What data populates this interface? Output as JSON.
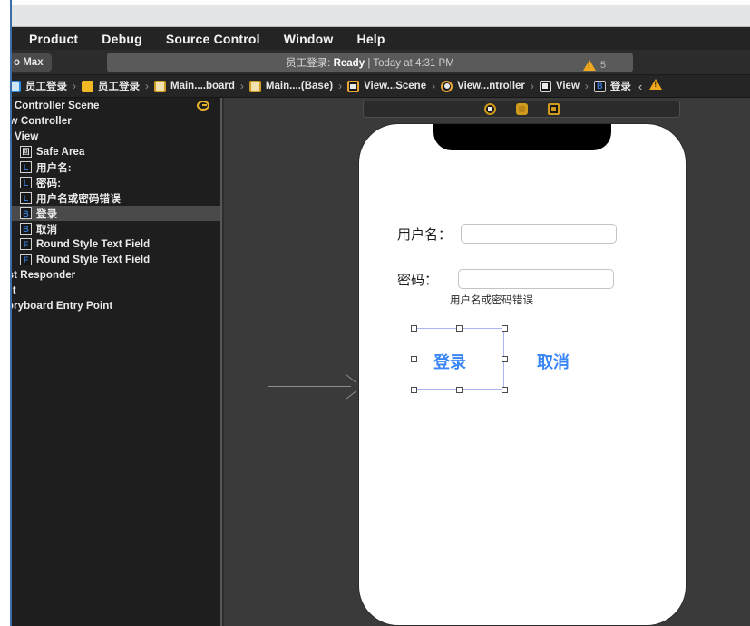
{
  "window": {
    "menu_items": [
      "Product",
      "Debug",
      "Source Control",
      "Window",
      "Help"
    ],
    "menu_clipped_first": ""
  },
  "toolbar": {
    "scheme_label": "o Max",
    "activity": {
      "project": "员工登录:",
      "status": "Ready",
      "separator": "|",
      "timestamp": "Today at 4:31 PM"
    },
    "warning_count": "5",
    "warning_icon": "warning-triangle-icon"
  },
  "breadcrumb": {
    "items": [
      {
        "label": "员工登录",
        "icon": "project-icon",
        "kind": "proj"
      },
      {
        "label": "员工登录",
        "icon": "folder-icon",
        "kind": "folder"
      },
      {
        "label": "Main....board",
        "icon": "storyboard-icon",
        "kind": "sb"
      },
      {
        "label": "Main....(Base)",
        "icon": "storyboard-localized-icon",
        "kind": "sb"
      },
      {
        "label": "View...Scene",
        "icon": "scene-icon",
        "kind": "scene"
      },
      {
        "label": "View...ntroller",
        "icon": "view-controller-icon",
        "kind": "vc"
      },
      {
        "label": "View",
        "icon": "view-icon",
        "kind": "view"
      },
      {
        "label": "登录",
        "icon": "button-icon",
        "kind": "btn",
        "badge": "B"
      }
    ],
    "separator": "›",
    "back_chevron": "‹",
    "warning_icon": "warning-triangle-icon"
  },
  "outline": {
    "rows": [
      {
        "label": "r Controller Scene",
        "icon": "",
        "indent": 8,
        "selected": false,
        "has_scene_arrow": true
      },
      {
        "label": "ew Controller",
        "icon": "",
        "indent": 4,
        "selected": false,
        "has_scene_arrow": false
      },
      {
        "label": "View",
        "icon": "",
        "indent": 16,
        "selected": false,
        "has_scene_arrow": false
      },
      {
        "label": "Safe Area",
        "icon": "回",
        "icon_class": "type-safe",
        "indent": 22,
        "selected": false,
        "has_scene_arrow": false
      },
      {
        "label": "用户名:",
        "icon": "L",
        "icon_class": "type-L",
        "indent": 22,
        "selected": false,
        "has_scene_arrow": false
      },
      {
        "label": "密码:",
        "icon": "L",
        "icon_class": "type-L",
        "indent": 22,
        "selected": false,
        "has_scene_arrow": false
      },
      {
        "label": "用户名或密码错误",
        "icon": "L",
        "icon_class": "type-L",
        "indent": 22,
        "selected": false,
        "has_scene_arrow": false
      },
      {
        "label": "登录",
        "icon": "B",
        "icon_class": "type-B",
        "indent": 22,
        "selected": true,
        "has_scene_arrow": false
      },
      {
        "label": "取消",
        "icon": "B",
        "icon_class": "type-B",
        "indent": 22,
        "selected": false,
        "has_scene_arrow": false
      },
      {
        "label": "Round Style Text Field",
        "icon": "F",
        "icon_class": "type-F",
        "indent": 22,
        "selected": false,
        "has_scene_arrow": false
      },
      {
        "label": "Round Style Text Field",
        "icon": "F",
        "icon_class": "type-F",
        "indent": 22,
        "selected": false,
        "has_scene_arrow": false
      },
      {
        "label": "rst Responder",
        "icon": "",
        "indent": 4,
        "selected": false,
        "has_scene_arrow": false
      },
      {
        "label": "xit",
        "icon": "",
        "indent": 4,
        "selected": false,
        "has_scene_arrow": false
      },
      {
        "label": "toryboard Entry Point",
        "icon": "",
        "indent": 4,
        "selected": false,
        "has_scene_arrow": false
      }
    ]
  },
  "canvas": {
    "device_bar_icons": [
      "view-as-device-icon",
      "orientation-icon",
      "variations-icon"
    ],
    "drag_arrow": "drag-connection-arrow"
  },
  "phone_screen": {
    "username_label": "用户名：",
    "username_value": "",
    "username_placeholder": "",
    "password_label": "密码：",
    "password_value": "",
    "password_placeholder": "",
    "error_label": "用户名或密码错误",
    "login_button": "登录",
    "cancel_button": "取消",
    "accent_color": "#3b86f7",
    "selection_color": "#a9b4f0"
  }
}
